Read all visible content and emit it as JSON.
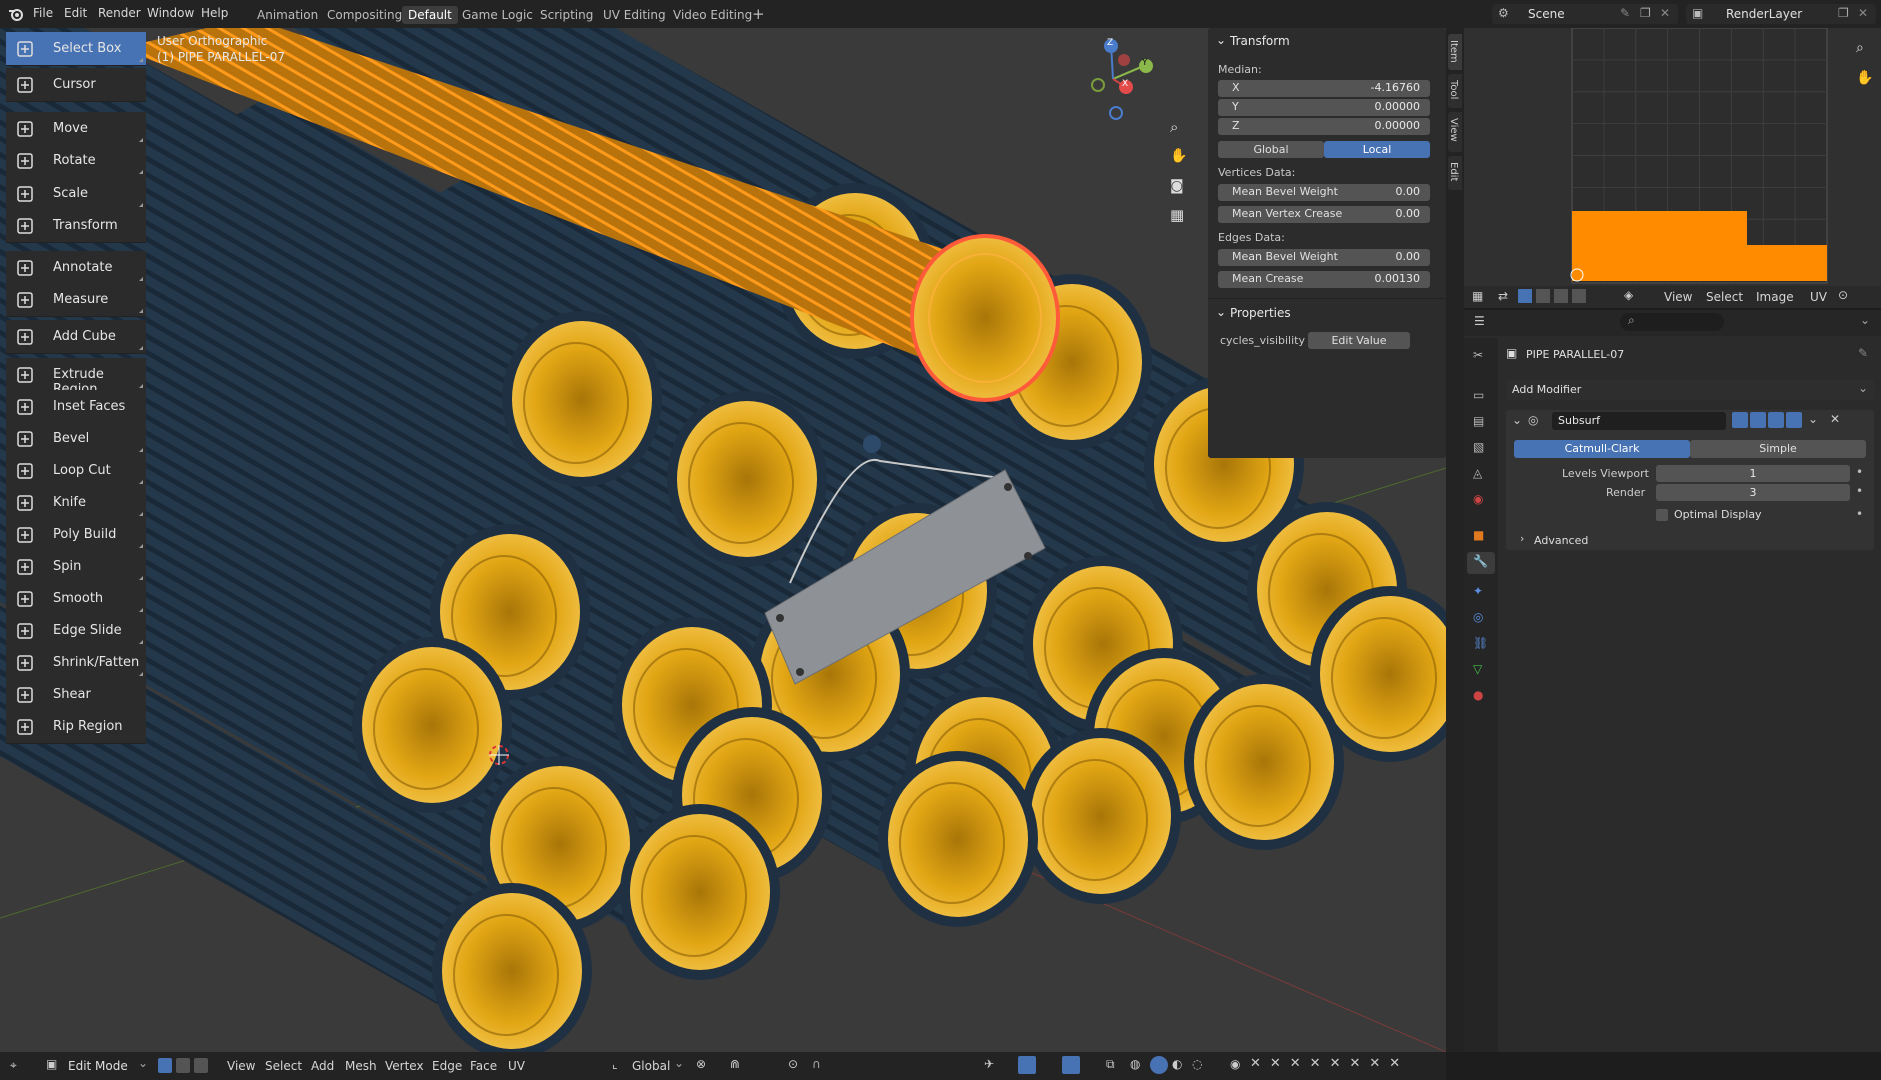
{
  "top_menu": {
    "file": "File",
    "edit": "Edit",
    "render": "Render",
    "window": "Window",
    "help": "Help"
  },
  "workspaces": [
    "Animation",
    "Compositing",
    "Default",
    "Game Logic",
    "Scripting",
    "UV Editing",
    "Video Editing"
  ],
  "active_workspace": "Default",
  "scene": {
    "label": "Scene",
    "render_layer": "RenderLayer"
  },
  "viewport": {
    "view_name": "User Orthographic",
    "object_name": "(1) PIPE PARALLEL-07"
  },
  "tools": [
    "Select Box",
    "Cursor",
    "Move",
    "Rotate",
    "Scale",
    "Transform",
    "Annotate",
    "Measure",
    "Add Cube",
    "Extrude Region",
    "Inset Faces",
    "Bevel",
    "Loop Cut",
    "Knife",
    "Poly Build",
    "Spin",
    "Smooth",
    "Edge Slide",
    "Shrink/Fatten",
    "Shear",
    "Rip Region"
  ],
  "active_tool": "Select Box",
  "gizmo": {
    "x": "X",
    "y": "Y",
    "z": "Z"
  },
  "npanel": {
    "transform_title": "Transform",
    "median_label": "Median:",
    "x_label": "X",
    "x_value": "-4.16760",
    "y_label": "Y",
    "y_value": "0.00000",
    "z_label": "Z",
    "z_value": "0.00000",
    "global_btn": "Global",
    "local_btn": "Local",
    "vertices_label": "Vertices Data:",
    "mean_bevel_weight_label": "Mean Bevel Weight",
    "mean_bevel_weight_v": "0.00",
    "mean_vertex_crease_label": "Mean Vertex Crease",
    "mean_vertex_crease_v": "0.00",
    "edges_label": "Edges Data:",
    "edge_bevel_label": "Mean Bevel Weight",
    "edge_bevel_v": "0.00",
    "mean_crease_label": "Mean Crease",
    "mean_crease_v": "0.00130",
    "properties_title": "Properties",
    "cycles_visibility": "cycles_visibility",
    "edit_value_btn": "Edit Value"
  },
  "ntabs": [
    "Item",
    "Tool",
    "View",
    "Edit"
  ],
  "uv_header": {
    "view": "View",
    "select": "Select",
    "image": "Image",
    "uv": "UV"
  },
  "properties": {
    "object_name": "PIPE PARALLEL-07",
    "add_modifier": "Add Modifier",
    "modifier_name": "Subsurf",
    "catmull": "Catmull-Clark",
    "simple": "Simple",
    "levels_viewport_label": "Levels Viewport",
    "levels_viewport_v": "1",
    "render_label": "Render",
    "render_v": "3",
    "optimal_display": "Optimal Display",
    "advanced": "Advanced"
  },
  "statusbar": {
    "mode": "Edit Mode",
    "view": "View",
    "select": "Select",
    "add": "Add",
    "mesh": "Mesh",
    "vertex": "Vertex",
    "edge": "Edge",
    "face": "Face",
    "uv": "UV",
    "orientation": "Global"
  },
  "colors": {
    "accent": "#4772b3",
    "selection": "#ff8c00",
    "pipe_outer": "#233446",
    "pipe_inner": "#e0a010"
  }
}
